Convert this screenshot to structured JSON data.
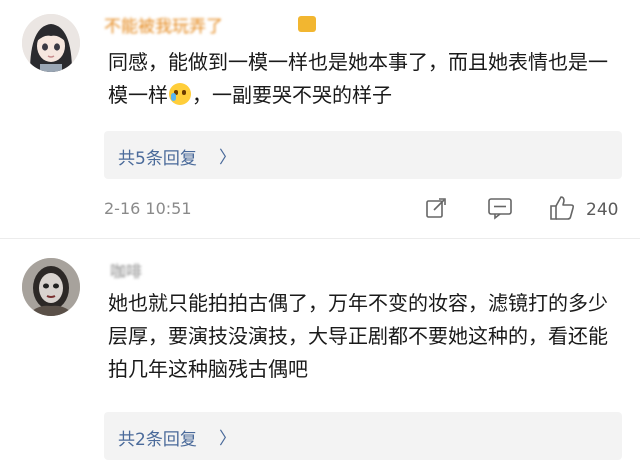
{
  "comments": [
    {
      "username": "不能被我玩弄了",
      "text_part1": "同感，能做到一模一样也是她本事了，而且她表情也是一模一样",
      "text_part2": "，一副要哭不哭的样子",
      "emoji_icon": "crying-laughing-emoji",
      "replies_label": "共5条回复",
      "arrow": "〉",
      "timestamp": "2-16 10:51",
      "like_count": "240"
    },
    {
      "username": "咖啡",
      "text": "她也就只能拍拍古偶了，万年不变的妆容，滤镜打的多少层厚，要演技没演技，大导正剧都不要她这种的，看还能拍几年这种脑残古偶吧",
      "replies_label": "共2条回复",
      "arrow": "〉"
    }
  ],
  "colors": {
    "username": "#e58a1f",
    "replies_link": "#4a6a9a",
    "replies_bg": "#f3f3f3",
    "meta_text": "#8a8a8a"
  },
  "icons": [
    "comment-share-icon",
    "comment-reply-icon",
    "like-thumb-icon"
  ]
}
